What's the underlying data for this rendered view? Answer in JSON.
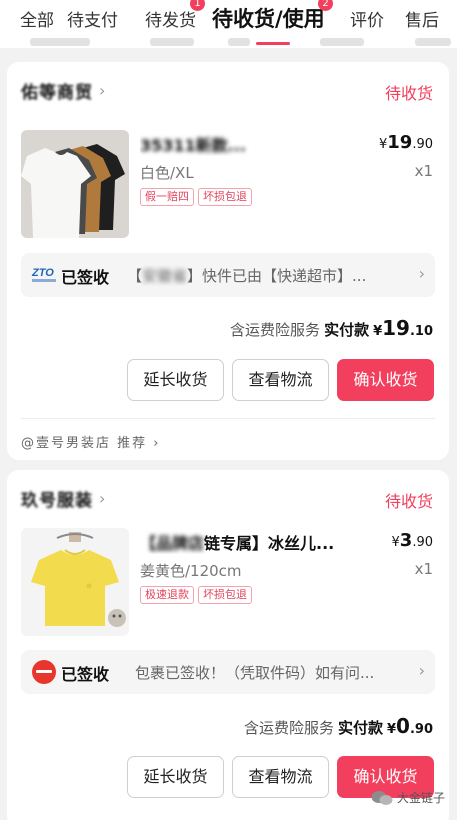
{
  "tabs": {
    "items": [
      {
        "label": "全部"
      },
      {
        "label": "待支付"
      },
      {
        "label": "待发货",
        "badge": "1"
      },
      {
        "label": "待收货/使用",
        "badge": "2"
      },
      {
        "label": "评价"
      },
      {
        "label": "售后"
      }
    ],
    "active_index": 3
  },
  "orders": [
    {
      "shop_name": "佑等商贸",
      "status": "待收货",
      "product_title": "35311新款...",
      "price_symbol": "¥",
      "price_int": "19",
      "price_dec": ".90",
      "spec": "白色/XL",
      "qty": "x1",
      "tags": [
        "假一赔四",
        "坏损包退"
      ],
      "tracking_signed": "已签收",
      "tracking_msg_prefix": "【",
      "tracking_msg_blur": "安徽省",
      "tracking_msg": "】快件已由【快递超市】...",
      "pay_service": "含运费险服务",
      "pay_label": "实付款",
      "pay_symbol": "¥",
      "pay_int": "19",
      "pay_dec": ".10",
      "buttons": {
        "extend": "延长收货",
        "logistics": "查看物流",
        "confirm": "确认收货"
      },
      "recommend": "@壹号男装店 推荐",
      "logo_text": "ZTO",
      "logo_color": "#1f64b8"
    },
    {
      "shop_name": "玖号服装",
      "status": "待收货",
      "product_title_blur": "【品牌店",
      "product_title": "链专属】冰丝儿...",
      "price_symbol": "¥",
      "price_int": "3",
      "price_dec": ".90",
      "spec": "姜黄色/120cm",
      "qty": "x1",
      "tags": [
        "极速退款",
        "坏损包退"
      ],
      "tracking_signed": "已签收",
      "tracking_msg": "包裹已签收！（凭取件码）如有问...",
      "pay_service": "含运费险服务",
      "pay_label": "实付款",
      "pay_symbol": "¥",
      "pay_int": "0",
      "pay_dec": ".90",
      "buttons": {
        "extend": "延长收货",
        "logistics": "查看物流",
        "confirm": "确认收货"
      },
      "logo_color": "#e8362c"
    }
  ],
  "watermark": "大金链子",
  "colors": {
    "accent": "#f23f5d",
    "background": "#f2f2f2"
  }
}
